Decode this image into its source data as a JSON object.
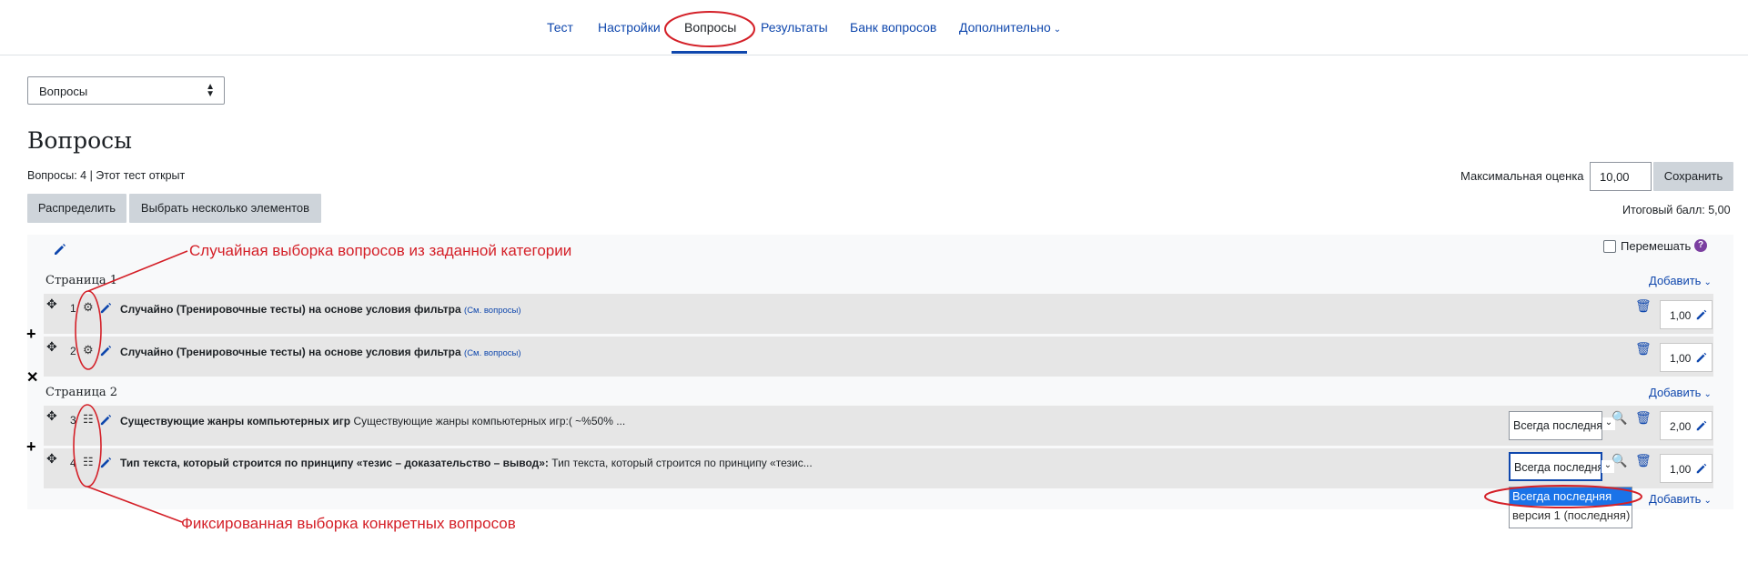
{
  "nav": {
    "tabs": [
      {
        "label": "Тест"
      },
      {
        "label": "Настройки"
      },
      {
        "label": "Вопросы"
      },
      {
        "label": "Результаты"
      },
      {
        "label": "Банк вопросов"
      },
      {
        "label": "Дополнительно"
      }
    ]
  },
  "page_select": {
    "value": "Вопросы"
  },
  "heading": "Вопросы",
  "info": "Вопросы: 4 | Этот тест открыт",
  "buttons": {
    "repaginate": "Распределить",
    "select_multiple": "Выбрать несколько элементов",
    "save": "Сохранить"
  },
  "max_grade": {
    "label": "Максимальная оценка",
    "value": "10,00"
  },
  "total": "Итоговый балл: 5,00",
  "shuffle_label": "Перемешать",
  "add_label": "Добавить",
  "pages": [
    {
      "label": "Страница 1"
    },
    {
      "label": "Страница 2"
    }
  ],
  "questions": [
    {
      "num": "1",
      "title": "Случайно (Тренировочные тесты) на основе условия фильтра",
      "see": "(См. вопросы)",
      "mark": "1,00"
    },
    {
      "num": "2",
      "title": "Случайно (Тренировочные тесты) на основе условия фильтра",
      "see": "(См. вопросы)",
      "mark": "1,00"
    },
    {
      "num": "3",
      "title": "Существующие жанры компьютерных игр",
      "preview": "Существующие жанры компьютерных игр:( ~%50% ...",
      "version": "Всегда последняя",
      "mark": "2,00"
    },
    {
      "num": "4",
      "title": "Тип текста, который строится по принципу «тезис – доказательство – вывод»:",
      "preview": "Тип текста, который строится по принципу «тезис...",
      "version": "Всегда последняя",
      "mark": "1,00"
    }
  ],
  "version_options": [
    "Всегда последняя",
    "версия 1 (последняя)"
  ],
  "annotations": {
    "random": "Случайная выборка вопросов из заданной категории",
    "fixed": "Фиксированная выборка конкретных вопросов"
  },
  "colors": {
    "link": "#0f47ad",
    "annotation": "#d42028",
    "row_bg": "#e6e6e6",
    "button_bg": "#ced4da",
    "selected_option": "#0d6efd"
  }
}
